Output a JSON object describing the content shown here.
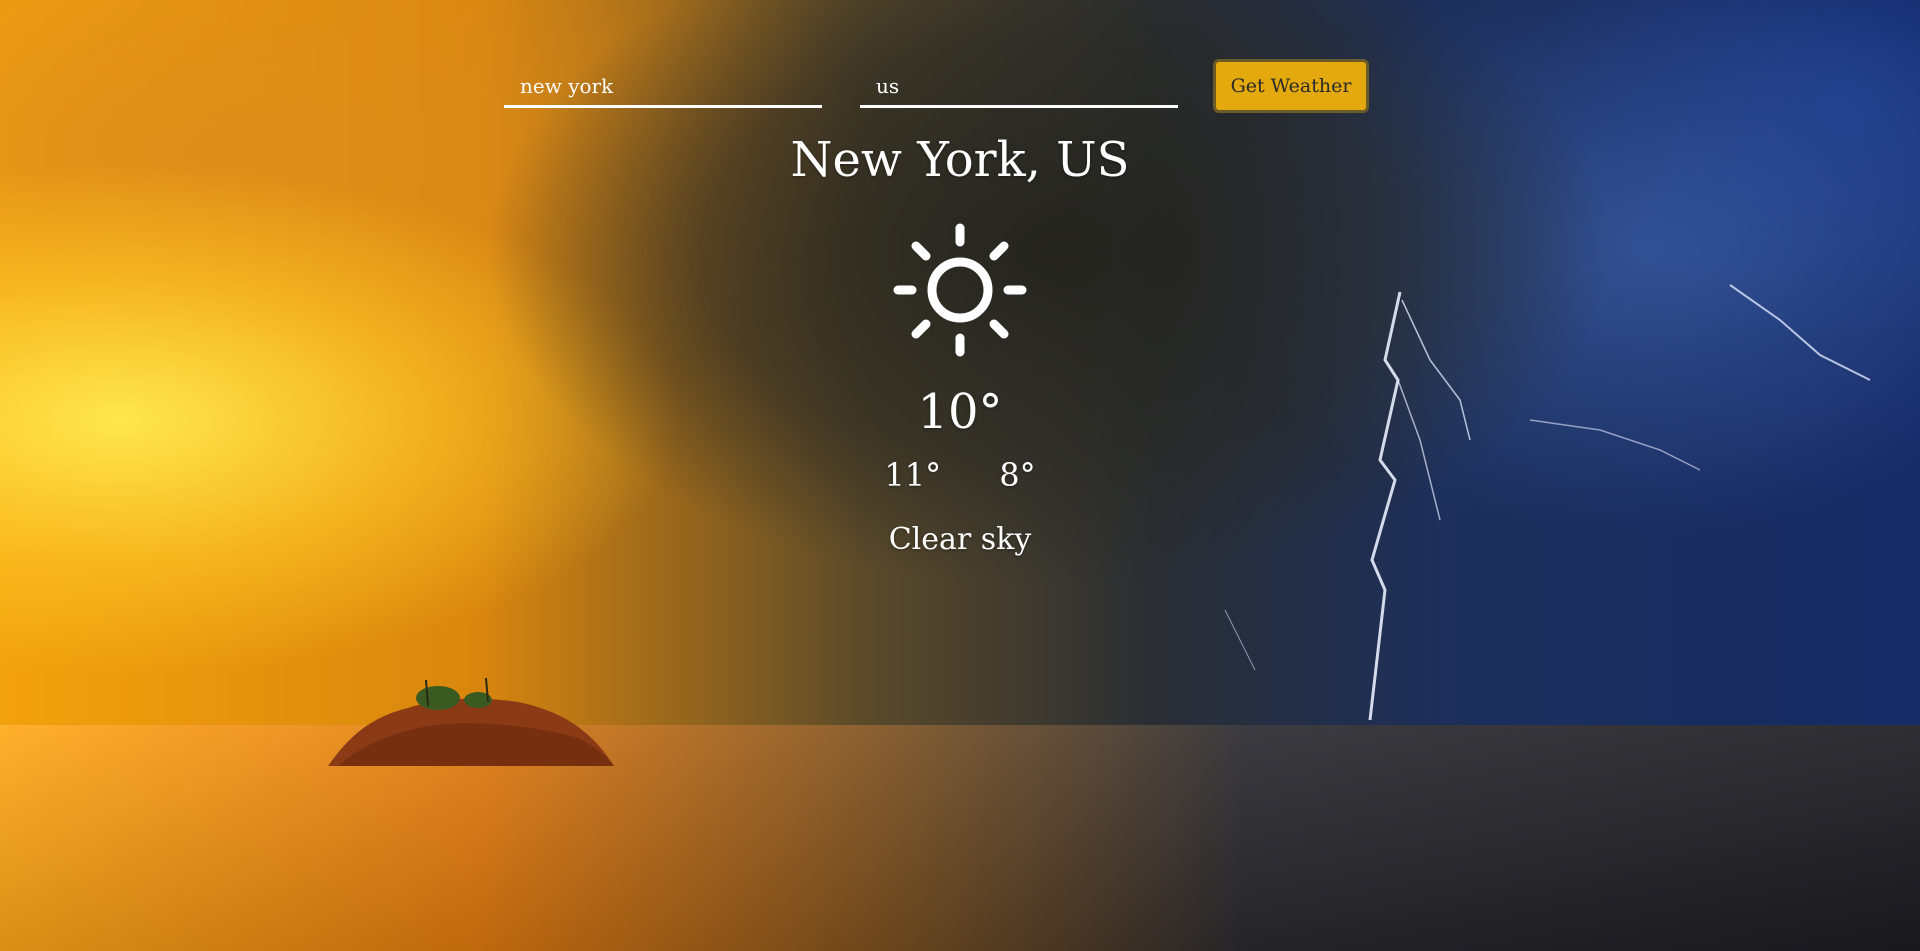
{
  "search": {
    "city_value": "new york",
    "country_value": "us",
    "button_label": "Get Weather"
  },
  "weather": {
    "location": "New York, US",
    "icon": "sun-icon",
    "temperature": "10°",
    "temp_max": "11°",
    "temp_min": "8°",
    "description": "Clear sky"
  },
  "colors": {
    "button_bg": "#e3a90d",
    "text": "#ffffff",
    "underline": "#ffffff"
  }
}
